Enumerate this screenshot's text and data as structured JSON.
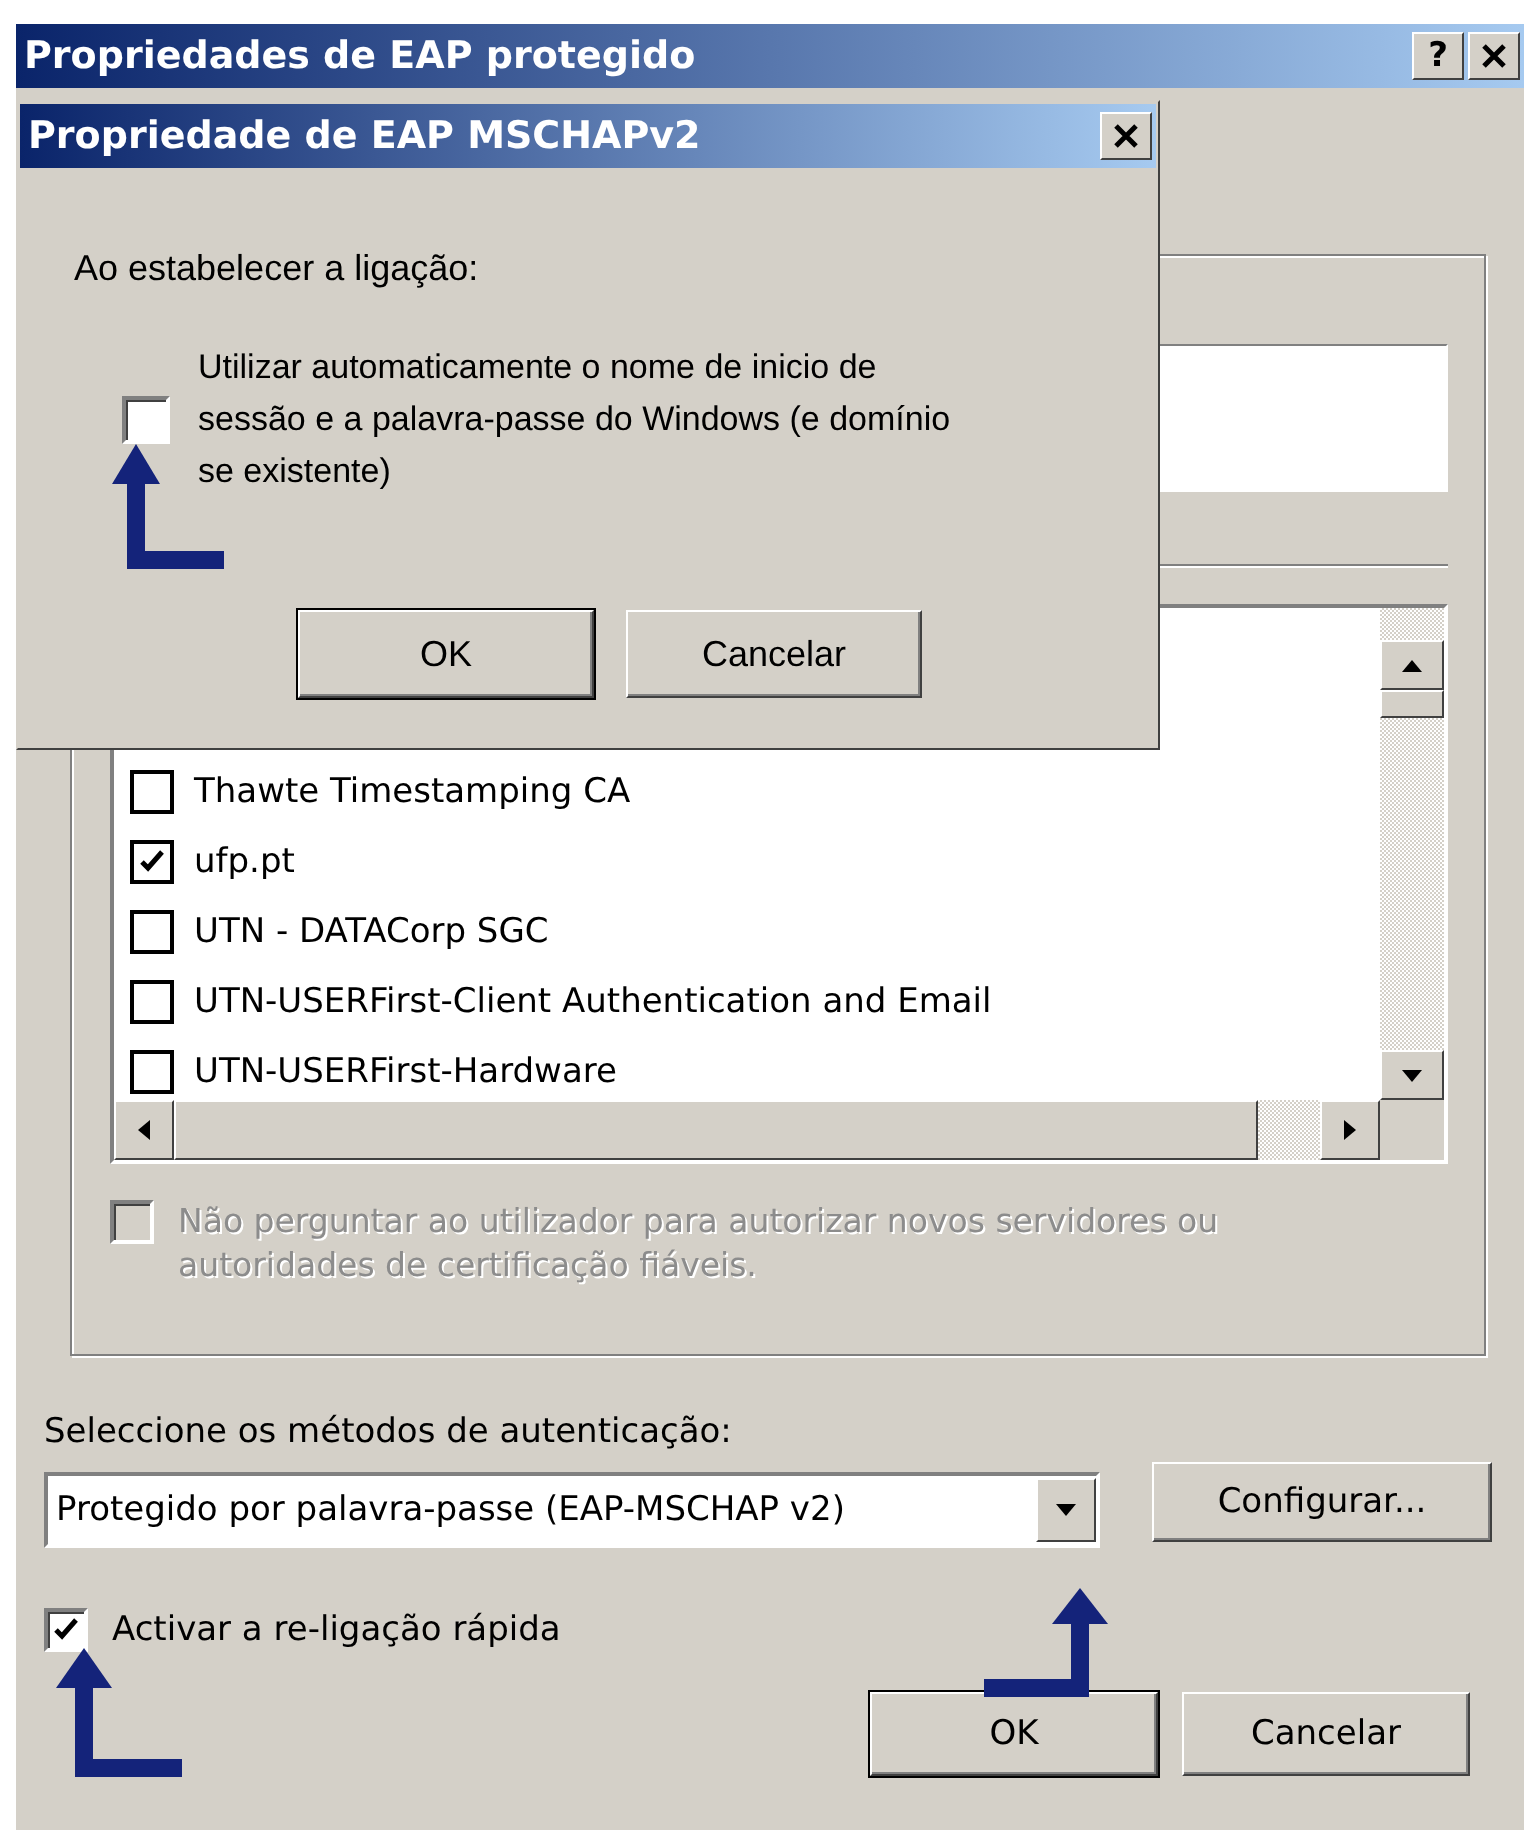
{
  "window": {
    "title": "Propriedades de EAP protegido",
    "help_button": "?"
  },
  "certificate_list": {
    "items": [
      {
        "label": "Thawte Timestamping CA",
        "checked": false
      },
      {
        "label": "ufp.pt",
        "checked": true
      },
      {
        "label": "UTN - DATACorp SGC",
        "checked": false
      },
      {
        "label": "UTN-USERFirst-Client Authentication and Email",
        "checked": false
      },
      {
        "label": "UTN-USERFirst-Hardware",
        "checked": false
      }
    ]
  },
  "no_prompt_option": {
    "label": "Não perguntar ao utilizador para autorizar novos servidores ou autoridades de certificação fiáveis.",
    "checked": false,
    "disabled": true
  },
  "auth_method_label": "Seleccione os métodos de autenticação:",
  "auth_method": {
    "value": "Protegido por palavra-passe (EAP-MSCHAP v2)"
  },
  "configure_button": "Configurar...",
  "fast_reconnect": {
    "label": "Activar a re-ligação rápida",
    "checked": true
  },
  "buttons": [
    "OK",
    "Cancelar"
  ],
  "inner_dialog": {
    "title": "Propriedade de EAP MSCHAPv2",
    "prompt": "Ao estabelecer a ligação:",
    "auto_logon": {
      "label": "Utilizar automaticamente o nome de inicio de sessão e a palavra-passe do Windows (e domínio se existente)",
      "checked": false
    },
    "buttons": [
      "OK",
      "Cancelar"
    ]
  }
}
